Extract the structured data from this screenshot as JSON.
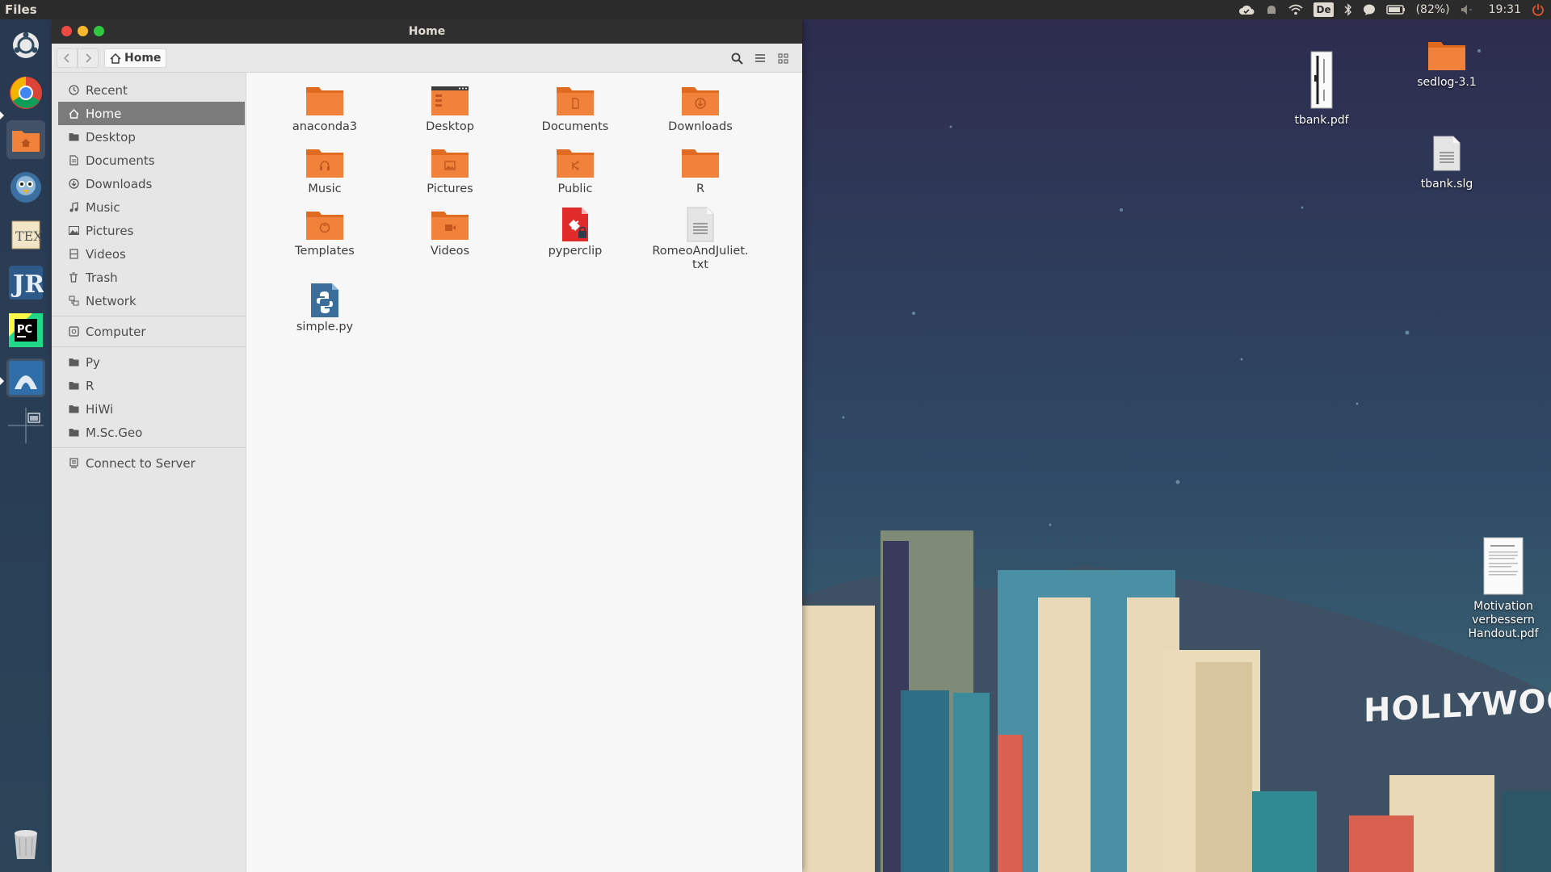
{
  "top_panel": {
    "app_name": "Files",
    "keyboard_layout": "De",
    "battery": "(82%)",
    "time": "19:31"
  },
  "launcher": {
    "items": [
      {
        "name": "dash-icon"
      },
      {
        "name": "chrome-icon"
      },
      {
        "name": "files-icon",
        "active": true
      },
      {
        "name": "thunderbird-icon"
      },
      {
        "name": "texstudio-icon"
      },
      {
        "name": "jabref-icon"
      },
      {
        "name": "pycharm-icon"
      },
      {
        "name": "blue-app-icon",
        "active": true
      },
      {
        "name": "workspace-switcher-icon"
      },
      {
        "name": "trash-icon"
      }
    ]
  },
  "window": {
    "title": "Home",
    "path": "Home",
    "sidebar": {
      "places": [
        {
          "label": "Recent",
          "icon": "clock-icon"
        },
        {
          "label": "Home",
          "icon": "home-icon",
          "selected": true
        },
        {
          "label": "Desktop",
          "icon": "folder-icon"
        },
        {
          "label": "Documents",
          "icon": "document-icon"
        },
        {
          "label": "Downloads",
          "icon": "download-icon"
        },
        {
          "label": "Music",
          "icon": "music-icon"
        },
        {
          "label": "Pictures",
          "icon": "picture-icon"
        },
        {
          "label": "Videos",
          "icon": "film-icon"
        },
        {
          "label": "Trash",
          "icon": "trash-icon"
        },
        {
          "label": "Network",
          "icon": "network-icon"
        }
      ],
      "devices": [
        {
          "label": "Computer",
          "icon": "drive-icon"
        }
      ],
      "bookmarks": [
        {
          "label": "Py",
          "icon": "folder-icon"
        },
        {
          "label": "R",
          "icon": "folder-icon"
        },
        {
          "label": "HiWi",
          "icon": "folder-icon"
        },
        {
          "label": "M.Sc.Geo",
          "icon": "folder-icon"
        }
      ],
      "network": [
        {
          "label": "Connect to Server",
          "icon": "server-icon"
        }
      ]
    },
    "files": [
      {
        "name": "anaconda3",
        "kind": "folder"
      },
      {
        "name": "Desktop",
        "kind": "folder-desktop"
      },
      {
        "name": "Documents",
        "kind": "folder-documents"
      },
      {
        "name": "Downloads",
        "kind": "folder-downloads"
      },
      {
        "name": "Music",
        "kind": "folder-music"
      },
      {
        "name": "Pictures",
        "kind": "folder-pictures"
      },
      {
        "name": "Public",
        "kind": "folder-public"
      },
      {
        "name": "R",
        "kind": "folder"
      },
      {
        "name": "Templates",
        "kind": "folder-templates"
      },
      {
        "name": "Videos",
        "kind": "folder-videos"
      },
      {
        "name": "pyperclip",
        "kind": "package"
      },
      {
        "name": "RomeoAndJuliet.\ntxt",
        "kind": "text"
      },
      {
        "name": "simple.py",
        "kind": "python"
      }
    ]
  },
  "desktop": {
    "items": [
      {
        "label": "tbank.pdf",
        "kind": "pdf-strip"
      },
      {
        "label": "sedlog-3.1",
        "kind": "folder"
      },
      {
        "label": "tbank.slg",
        "kind": "text"
      },
      {
        "label": "Motivation verbessern Handout.pdf",
        "kind": "pdf"
      }
    ],
    "sign": "HOLLYWOOD"
  },
  "colors": {
    "folder_orange": "#f0823c",
    "folder_orange_dark": "#e06a1f",
    "selection_gray": "#7b7b7b",
    "panel_bg": "#2b2b2b"
  }
}
